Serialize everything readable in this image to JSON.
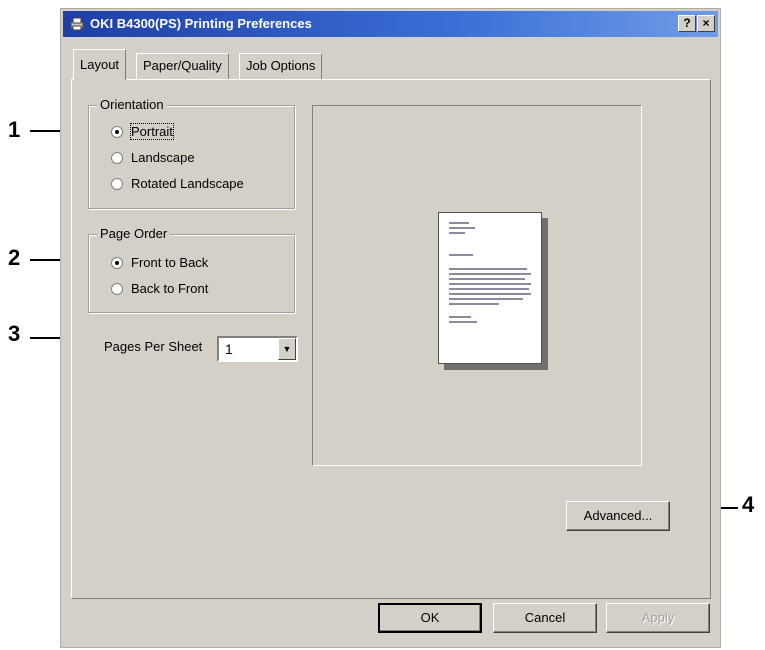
{
  "window": {
    "title": "OKI B4300(PS) Printing Preferences",
    "help_btn": "?",
    "close_btn": "×"
  },
  "tabs": [
    {
      "label": "Layout",
      "active": true
    },
    {
      "label": "Paper/Quality",
      "active": false
    },
    {
      "label": "Job Options",
      "active": false
    }
  ],
  "orientation": {
    "legend": "Orientation",
    "options": [
      {
        "label": "Portrait",
        "selected": true
      },
      {
        "label": "Landscape",
        "selected": false
      },
      {
        "label": "Rotated Landscape",
        "selected": false
      }
    ]
  },
  "page_order": {
    "legend": "Page Order",
    "options": [
      {
        "label": "Front to Back",
        "selected": true
      },
      {
        "label": "Back to Front",
        "selected": false
      }
    ]
  },
  "pages_per_sheet": {
    "label": "Pages Per Sheet",
    "value": "1"
  },
  "buttons": {
    "advanced": "Advanced...",
    "ok": "OK",
    "cancel": "Cancel",
    "apply": "Apply"
  },
  "callouts": [
    "1",
    "2",
    "3",
    "4"
  ]
}
